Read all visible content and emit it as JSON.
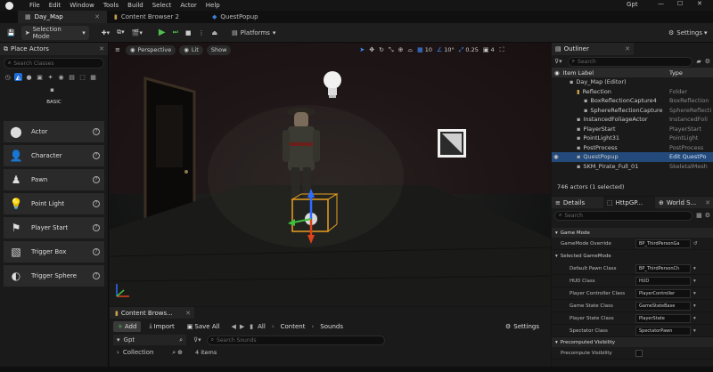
{
  "menu": [
    "File",
    "Edit",
    "Window",
    "Tools",
    "Build",
    "Select",
    "Actor",
    "Help"
  ],
  "user": "Gpt",
  "tabs": [
    "Day_Map",
    "Content Browser 2",
    "QuestPopup"
  ],
  "toolbar": {
    "selection_mode": "Selection Mode",
    "platforms": "Platforms",
    "settings": "Settings"
  },
  "left_panel": {
    "tab": "Place Actors",
    "search_placeholder": "Search Classes",
    "category": "BASIC",
    "items": [
      {
        "label": "Actor",
        "icon": "sphere-icon"
      },
      {
        "label": "Character",
        "icon": "character-icon"
      },
      {
        "label": "Pawn",
        "icon": "pawn-icon"
      },
      {
        "label": "Point Light",
        "icon": "lightbulb-icon"
      },
      {
        "label": "Player Start",
        "icon": "flag-icon"
      },
      {
        "label": "Trigger Box",
        "icon": "box-icon"
      },
      {
        "label": "Trigger Sphere",
        "icon": "sphere-icon"
      }
    ]
  },
  "viewport": {
    "perspective": "Perspective",
    "lit": "Lit",
    "show": "Show",
    "grid_snap": "10",
    "rot_snap": "10°",
    "scale_snap": "0.25",
    "camera_speed": "4"
  },
  "outliner": {
    "tab": "Outliner",
    "search_placeholder": "Search",
    "col_label": "Item Label",
    "col_type": "Type",
    "rows": [
      {
        "name": "Day_Map (Editor)",
        "type": "",
        "indent": 1,
        "selected": false
      },
      {
        "name": "Reflection",
        "type": "Folder",
        "indent": 2,
        "selected": false
      },
      {
        "name": "BoxReflectionCapture4",
        "type": "BoxReflection",
        "indent": 3,
        "selected": false
      },
      {
        "name": "SphereReflectionCapture",
        "type": "SphereReflecti",
        "indent": 3,
        "selected": false
      },
      {
        "name": "InstancedFoliageActor",
        "type": "InstancedFoli",
        "indent": 2,
        "selected": false
      },
      {
        "name": "PlayerStart",
        "type": "PlayerStart",
        "indent": 2,
        "selected": false
      },
      {
        "name": "PointLight31",
        "type": "PointLight",
        "indent": 2,
        "selected": false
      },
      {
        "name": "PostProcess",
        "type": "PostProcess",
        "indent": 2,
        "selected": false
      },
      {
        "name": "QuestPopup",
        "type": "Edit QuestPo",
        "indent": 2,
        "selected": true
      },
      {
        "name": "SKM_Pirate_Full_01",
        "type": "SkeletalMesh",
        "indent": 2,
        "selected": false
      }
    ],
    "status": "746 actors (1 selected)"
  },
  "details": {
    "tabs": [
      "Details",
      "HttpGP...",
      "World S..."
    ],
    "search_placeholder": "Search",
    "game_mode_section": "Game Mode",
    "gamemode_override_label": "GameMode Override",
    "gamemode_override_value": "BP_ThirdPersonGa",
    "selected_gamemode": "Selected GameMode",
    "props": [
      {
        "key": "Default Pawn Class",
        "value": "BP_ThirdPersonCh"
      },
      {
        "key": "HUD Class",
        "value": "HUD"
      },
      {
        "key": "Player Controller Class",
        "value": "PlayerController"
      },
      {
        "key": "Game State Class",
        "value": "GameStateBase"
      },
      {
        "key": "Player State Class",
        "value": "PlayerState"
      },
      {
        "key": "Spectator Class",
        "value": "SpectatorPawn"
      }
    ],
    "precomputed_section": "Precomputed Visibility",
    "precompute_label": "Precompute Visibility"
  },
  "content_browser": {
    "tab": "Content Brows...",
    "add": "Add",
    "import": "Import",
    "save_all": "Save All",
    "path": [
      "All",
      "Content",
      "Sounds"
    ],
    "settings": "Settings",
    "tree_root": "Gpt",
    "collections": "Collection",
    "search_placeholder": "Search Sounds",
    "item_count": "4 items"
  }
}
